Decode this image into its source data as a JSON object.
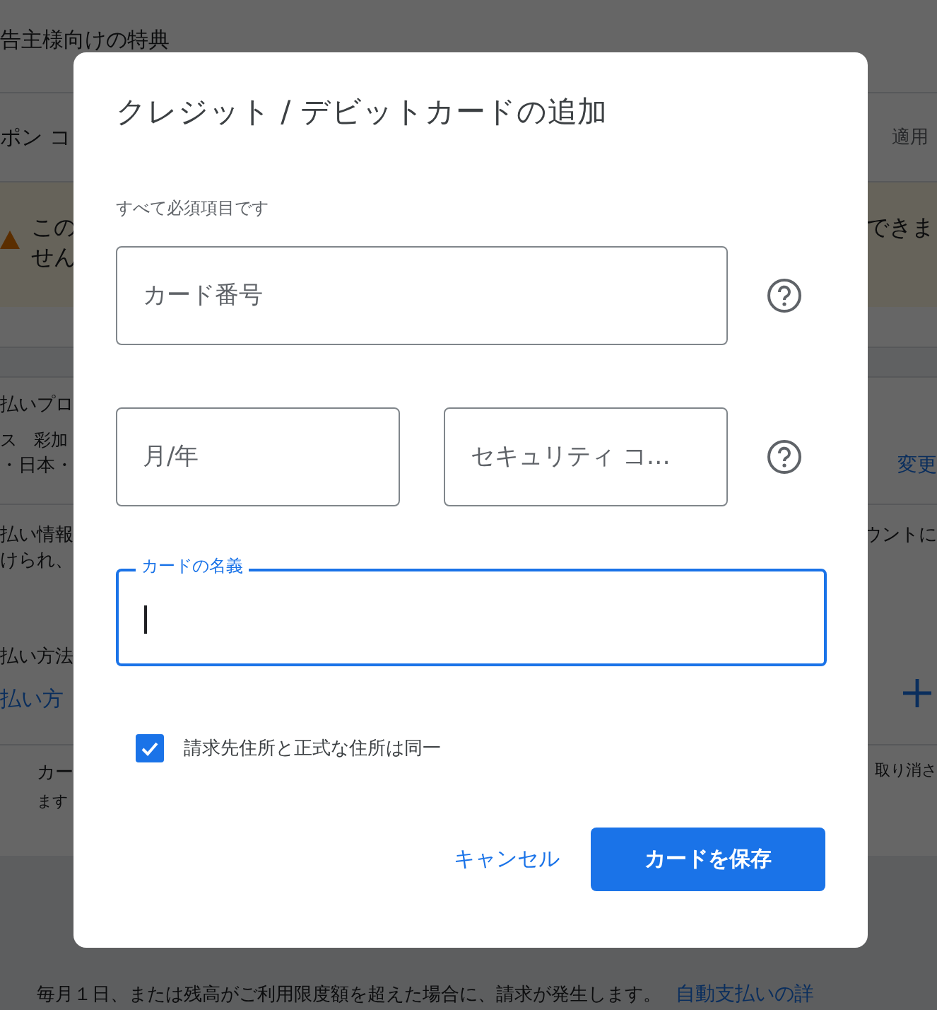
{
  "page": {
    "heading": "告主様向けの特典",
    "coupon_row": {
      "label": "ポン コ",
      "action": "適用"
    },
    "warning": {
      "lines": [
        "この",
        "せん"
      ],
      "right": "できま"
    },
    "payment_profile": {
      "label": "払いプロ",
      "name": "ス　彩加",
      "address": "・日本・",
      "action": "変更"
    },
    "payment_info": {
      "lines": [
        "払い情報",
        "けられ、"
      ],
      "right": "ウントに"
    },
    "payment_method": {
      "label": "払い方法",
      "title": "払い方"
    },
    "card_note": {
      "lines": [
        "カー",
        "ます"
      ],
      "right": "取り消さ"
    },
    "footer": {
      "text": "毎月１日、または残高がご利用限度額を超えた場合に、請求が発生します。",
      "link": "自動支払いの詳"
    }
  },
  "dialog": {
    "title": "クレジット / デビットカードの追加",
    "required_note": "すべて必須項目です",
    "card_number": {
      "placeholder": "カード番号"
    },
    "expiry": {
      "placeholder": "月/年"
    },
    "security_code": {
      "placeholder": "セキュリティ コ…"
    },
    "cardholder": {
      "label": "カードの名義",
      "focused": true
    },
    "same_address": {
      "label": "請求先住所と正式な住所は同一",
      "checked": true
    },
    "buttons": [
      {
        "label": "キャンセル",
        "kind": "text"
      },
      {
        "label": "カードを保存",
        "kind": "filled"
      }
    ]
  }
}
